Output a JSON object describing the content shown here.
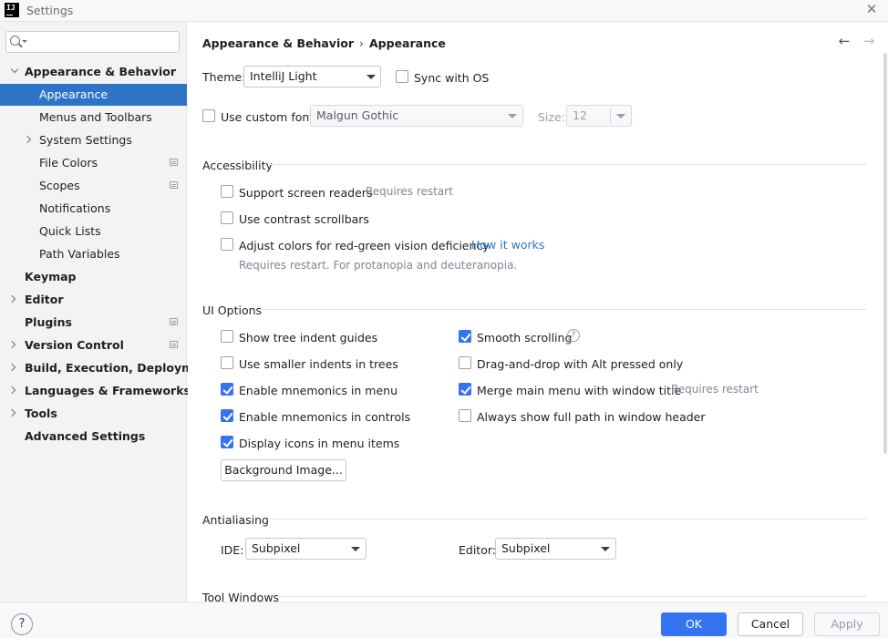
{
  "window": {
    "title": "Settings",
    "app_icon": "intellij-icon"
  },
  "sidebar": {
    "search": {
      "value": "",
      "placeholder": ""
    },
    "items": [
      {
        "label": "Appearance & Behavior",
        "expanded": true,
        "bold": true
      },
      {
        "label": "Appearance",
        "selected": true
      },
      {
        "label": "Menus and Toolbars"
      },
      {
        "label": "System Settings",
        "expandable": true
      },
      {
        "label": "File Colors",
        "project_icon": true
      },
      {
        "label": "Scopes",
        "project_icon": true
      },
      {
        "label": "Notifications"
      },
      {
        "label": "Quick Lists"
      },
      {
        "label": "Path Variables"
      },
      {
        "label": "Keymap",
        "bold": true
      },
      {
        "label": "Editor",
        "bold": true,
        "expandable": true
      },
      {
        "label": "Plugins",
        "bold": true,
        "project_icon": true
      },
      {
        "label": "Version Control",
        "bold": true,
        "expandable": true,
        "project_icon": true
      },
      {
        "label": "Build, Execution, Deployment",
        "bold": true,
        "expandable": true
      },
      {
        "label": "Languages & Frameworks",
        "bold": true,
        "expandable": true
      },
      {
        "label": "Tools",
        "bold": true,
        "expandable": true
      },
      {
        "label": "Advanced Settings",
        "bold": true
      }
    ]
  },
  "breadcrumb": {
    "parent": "Appearance & Behavior",
    "separator": "›",
    "current": "Appearance"
  },
  "theme": {
    "label": "Theme:",
    "value": "IntelliJ Light",
    "sync_label": "Sync with OS",
    "sync_checked": false
  },
  "font": {
    "checkbox_label": "Use custom font:",
    "checked": false,
    "value": "Malgun Gothic",
    "size_label": "Size:",
    "size_value": "12"
  },
  "accessibility": {
    "title": "Accessibility",
    "screen_readers": {
      "label": "Support screen readers",
      "checked": false,
      "hint": "Requires restart"
    },
    "contrast_scrollbars": {
      "label": "Use contrast scrollbars",
      "checked": false
    },
    "color_deficiency": {
      "label": "Adjust colors for red-green vision deficiency",
      "checked": false,
      "link": "How it works",
      "hint": "Requires restart. For protanopia and deuteranopia."
    }
  },
  "ui_options": {
    "title": "UI Options",
    "left": [
      {
        "label": "Show tree indent guides",
        "checked": false
      },
      {
        "label": "Use smaller indents in trees",
        "checked": false
      },
      {
        "label": "Enable mnemonics in menu",
        "checked": true
      },
      {
        "label": "Enable mnemonics in controls",
        "checked": true
      },
      {
        "label": "Display icons in menu items",
        "checked": true
      }
    ],
    "right": [
      {
        "label": "Smooth scrolling",
        "checked": true,
        "help": "?"
      },
      {
        "label": "Drag-and-drop with Alt pressed only",
        "checked": false
      },
      {
        "label": "Merge main menu with window title",
        "checked": true,
        "hint": "Requires restart"
      },
      {
        "label": "Always show full path in window header",
        "checked": false
      }
    ],
    "background_button": "Background Image..."
  },
  "antialiasing": {
    "title": "Antialiasing",
    "ide_label": "IDE:",
    "ide_value": "Subpixel",
    "editor_label": "Editor:",
    "editor_value": "Subpixel"
  },
  "tool_windows": {
    "title": "Tool Windows"
  },
  "footer": {
    "help": "?",
    "ok": "OK",
    "cancel": "Cancel",
    "apply": "Apply"
  },
  "colors": {
    "accent": "#3574f0",
    "selection": "#2d74c9",
    "link": "#2d74c9",
    "hint": "#818594"
  }
}
